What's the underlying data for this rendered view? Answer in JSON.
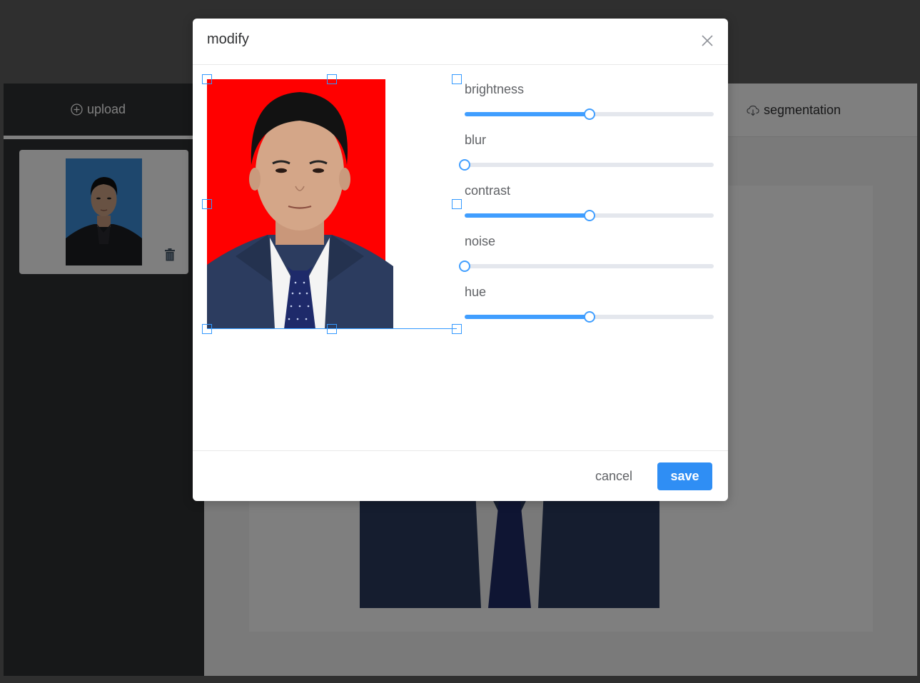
{
  "app": {
    "upload_label": "upload",
    "segmentation_label": "segmentation"
  },
  "modal": {
    "title": "modify",
    "sliders": [
      {
        "label": "brightness",
        "value": 0.5
      },
      {
        "label": "blur",
        "value": 0.0
      },
      {
        "label": "contrast",
        "value": 0.5
      },
      {
        "label": "noise",
        "value": 0.0
      },
      {
        "label": "hue",
        "value": 0.5
      }
    ],
    "cancel_label": "cancel",
    "save_label": "save"
  },
  "colors": {
    "accent": "#409eff",
    "save_button": "#2f8ef4",
    "photo_background_edit": "#ff0000",
    "photo_background_thumb": "#3d8fdb",
    "sidebar": "#2f3033"
  },
  "icons": {
    "upload": "plus-circle-icon",
    "delete": "trash-icon",
    "segmentation": "cloud-download-icon",
    "close": "close-icon"
  }
}
